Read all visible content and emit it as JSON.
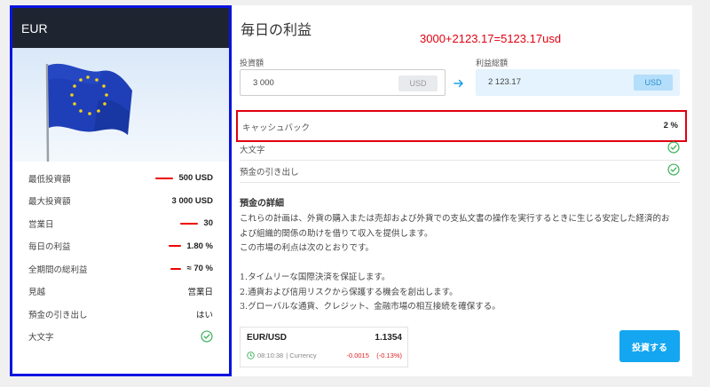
{
  "plan": {
    "currency": "EUR",
    "stats": [
      {
        "label": "最低投資額",
        "value": "500 USD"
      },
      {
        "label": "最大投資額",
        "value": "3 000 USD"
      },
      {
        "label": "営業日",
        "value": "30"
      },
      {
        "label": "毎日の利益",
        "value": "1.80 %"
      },
      {
        "label": "全期間の総利益",
        "value": "≈ 70 %"
      },
      {
        "label": "見越",
        "value": "営業日"
      },
      {
        "label": "預金の引き出し",
        "value": "はい"
      },
      {
        "label": "大文字",
        "value": ""
      }
    ]
  },
  "calculator": {
    "title": "毎日の利益",
    "annotation": "3000+2123.17=5123.17usd",
    "invest_label": "投資額",
    "invest_value": "3 000",
    "invest_currency": "USD",
    "result_label": "利益総額",
    "result_value": "2 123.17",
    "result_currency": "USD",
    "cashback_label": "キャッシュバック",
    "cashback_value": "2 %",
    "feature_capital": "大文字",
    "feature_withdrawal": "預金の引き出し"
  },
  "details": {
    "title": "預金の詳細",
    "line1": "これらの計画は、外貨の購入または売却および外貨での支払文書の操作を実行するときに生じる安定した経済的お",
    "line2": "よび組織的関係の助けを借りて収入を提供します。",
    "line3": "この市場の利点は次のとおりです。",
    "item1": "1.タイムリーな国際決済を保証します。",
    "item2": "2.通貨および信用リスクから保護する機会を創出します。",
    "item3": "3.グローバルな通貨、クレジット、金融市場の相互接続を確保する。"
  },
  "quote": {
    "pair": "EUR/USD",
    "price": "1.1354",
    "time": "08:10:38",
    "source": "| Currency",
    "change": "-0.0015",
    "change_pct": "(-0.13%)"
  },
  "invest_button": "投資する",
  "colors": {
    "highlight_border": "#0a14e0",
    "annotation_red": "#e00010",
    "accent_blue": "#14a6f0",
    "check_green": "#3cb35a"
  }
}
